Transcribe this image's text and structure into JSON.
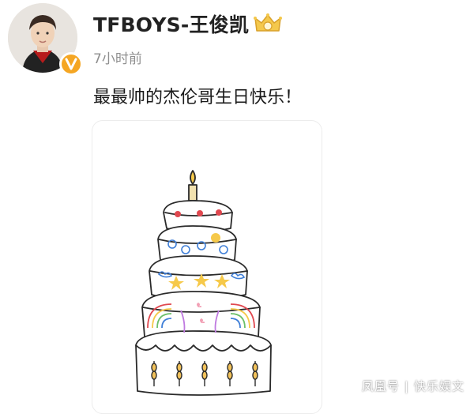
{
  "post": {
    "username": "TFBOYS-王俊凯",
    "time": "7小时前",
    "text": "最最帅的杰伦哥生日快乐！"
  },
  "badges": {
    "verified_color": "#f5a623",
    "crown_icon": "crown-badge-icon"
  },
  "image": {
    "subject": "hand-drawn five-tier birthday cake with a candle"
  },
  "watermark": {
    "source": "凤凰号",
    "separator": "|",
    "author": "快乐娱文"
  }
}
